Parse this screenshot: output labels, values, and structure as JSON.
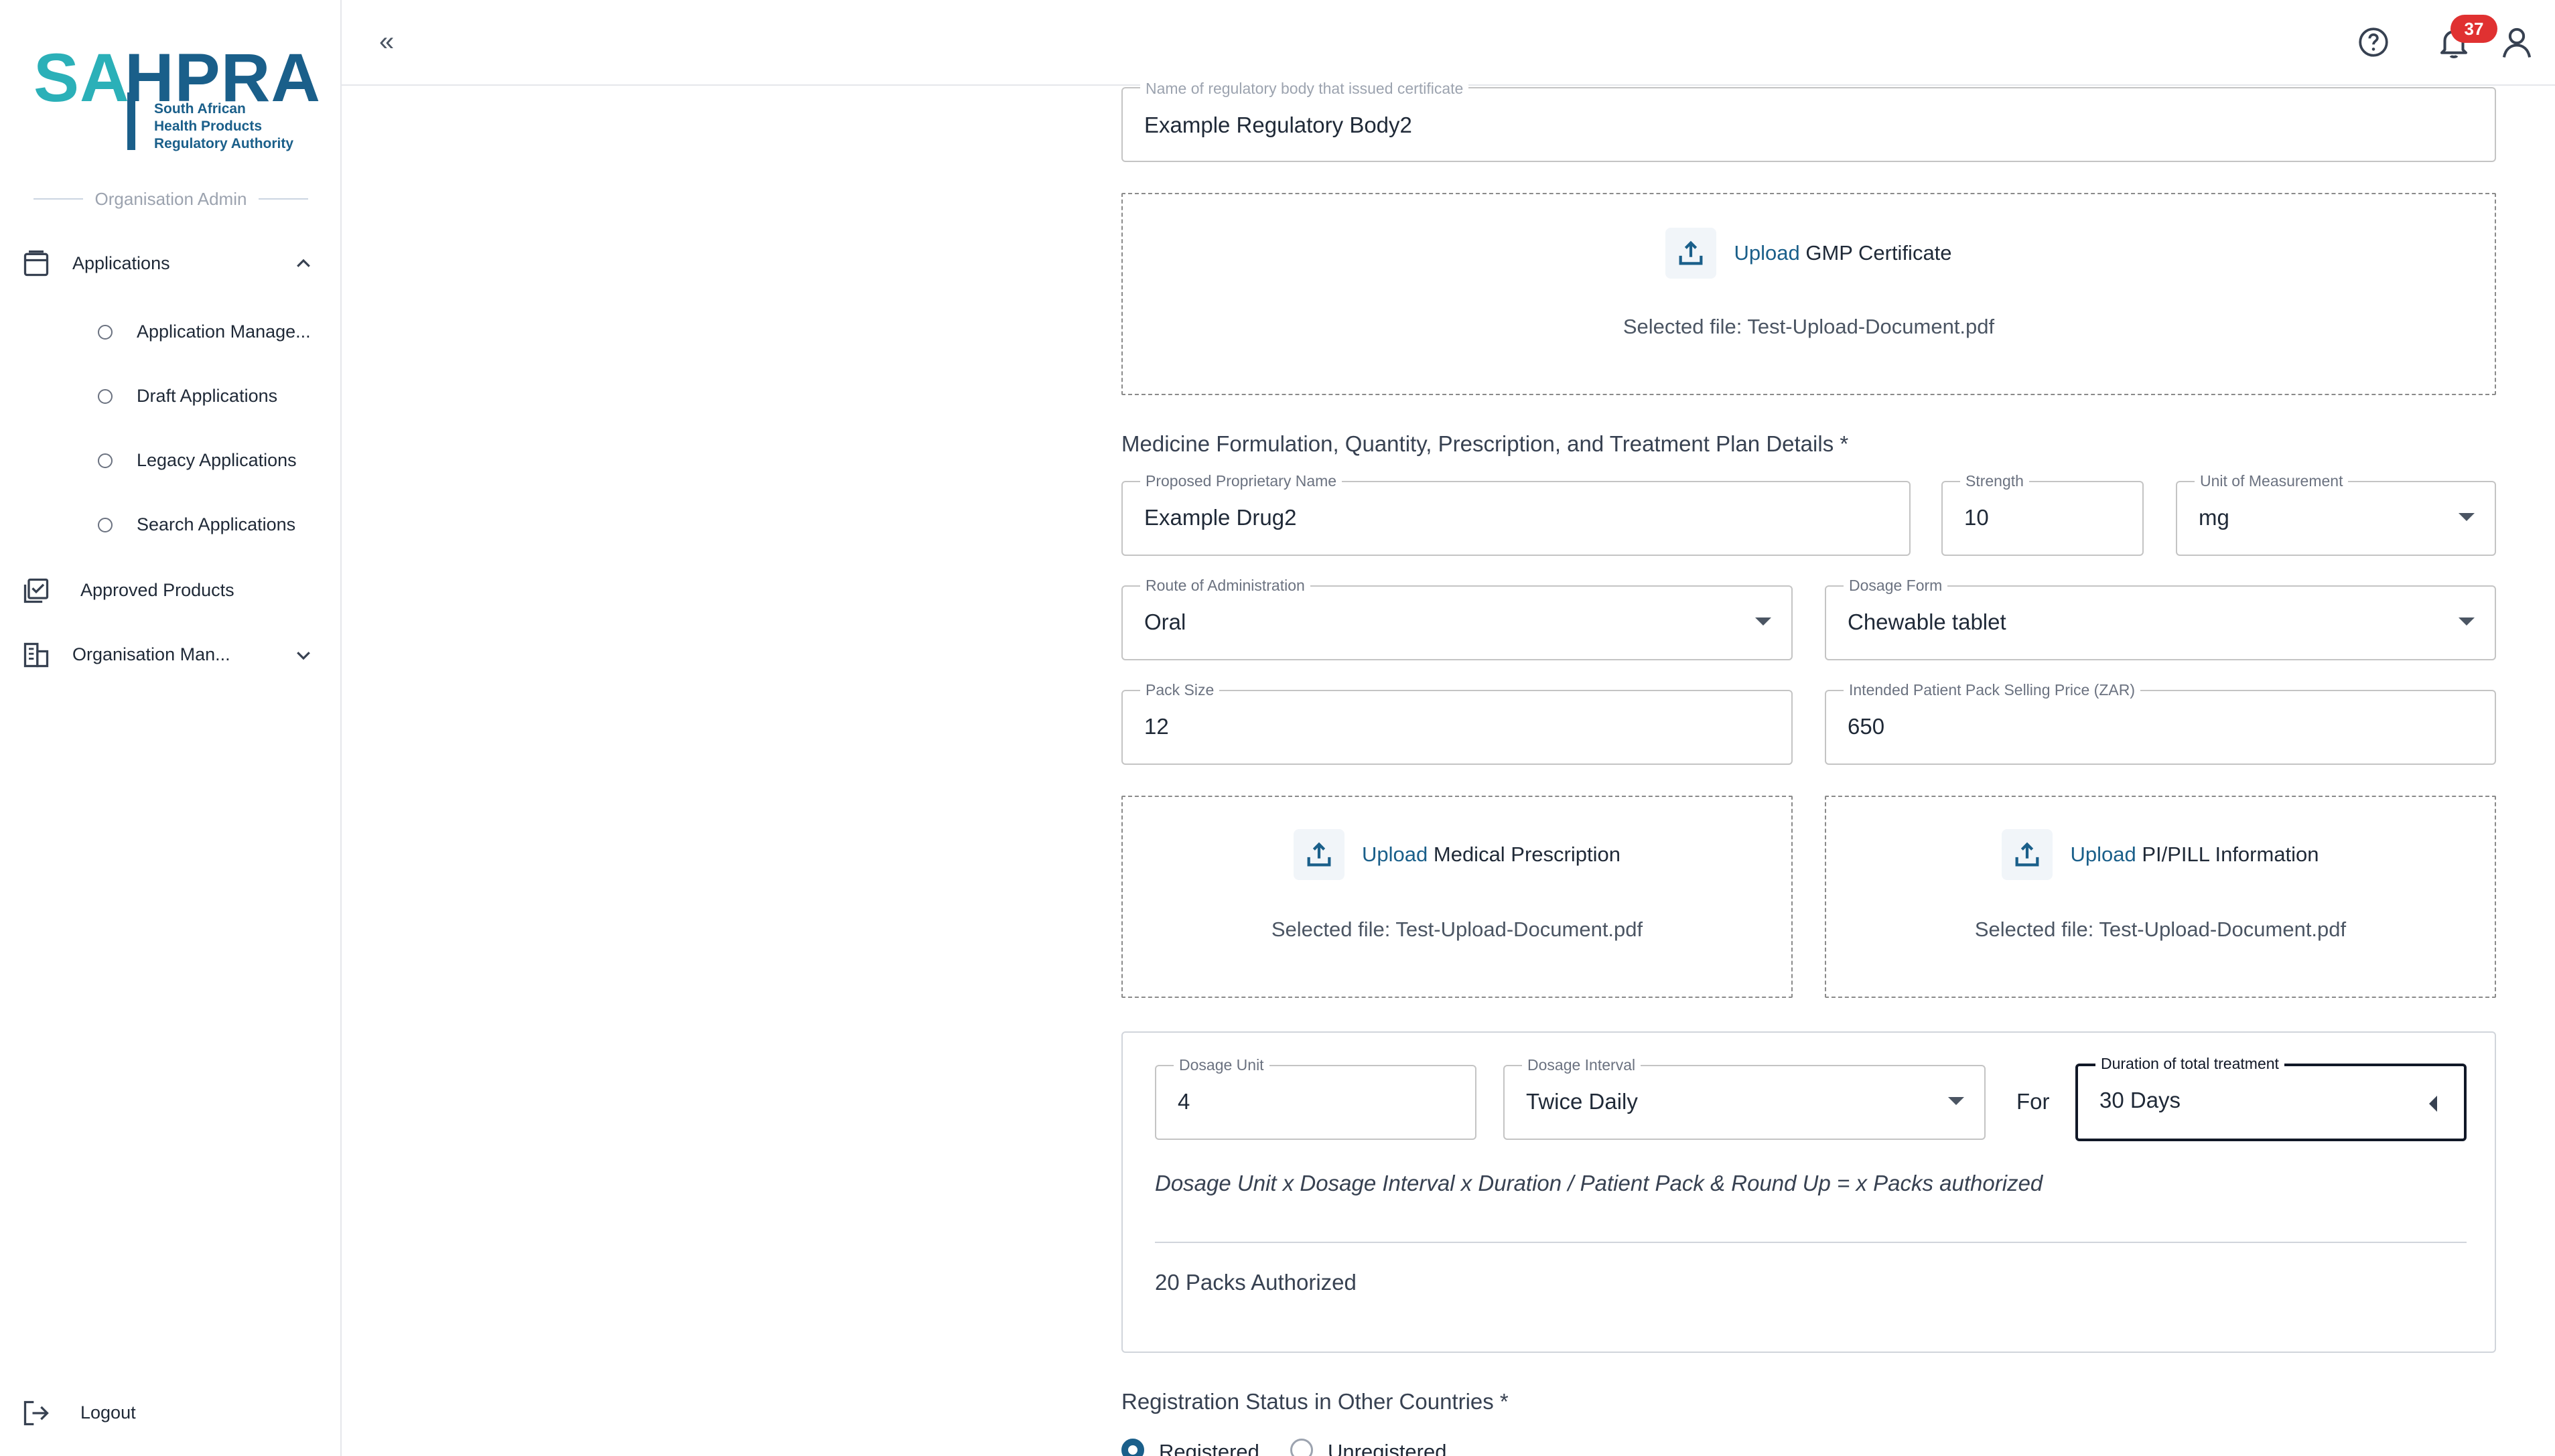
{
  "logo": {
    "short_a": "SA",
    "short_b": "HPRA",
    "line1": "South African",
    "line2": "Health Products",
    "line3": "Regulatory Authority"
  },
  "sidebar": {
    "role": "Organisation Admin",
    "applications_label": "Applications",
    "sub_items": [
      {
        "label": "Application Manage..."
      },
      {
        "label": "Draft Applications"
      },
      {
        "label": "Legacy Applications"
      },
      {
        "label": "Search Applications"
      }
    ],
    "approved_products_label": "Approved Products",
    "organisation_label": "Organisation Man...",
    "logout_label": "Logout"
  },
  "topbar": {
    "collapse_glyph": "«",
    "notification_count": "37"
  },
  "form": {
    "regulatory_body": {
      "label": "Name of regulatory body that issued certificate",
      "value": "Example Regulatory Body2"
    },
    "gmp_upload": {
      "link": "Upload",
      "label": "GMP Certificate",
      "selected": "Selected file: Test-Upload-Document.pdf"
    },
    "section_title": "Medicine Formulation, Quantity, Prescription, and Treatment Plan Details *",
    "proprietary_name": {
      "label": "Proposed Proprietary Name",
      "value": "Example Drug2"
    },
    "strength": {
      "label": "Strength",
      "value": "10"
    },
    "unit": {
      "label": "Unit of Measurement",
      "value": "mg"
    },
    "route": {
      "label": "Route of Administration",
      "value": "Oral"
    },
    "dosage_form": {
      "label": "Dosage Form",
      "value": "Chewable tablet"
    },
    "pack_size": {
      "label": "Pack Size",
      "value": "12"
    },
    "price": {
      "label": "Intended Patient Pack Selling Price (ZAR)",
      "value": "650"
    },
    "prescription_upload": {
      "link": "Upload",
      "label": "Medical Prescription",
      "selected": "Selected file: Test-Upload-Document.pdf"
    },
    "pi_upload": {
      "link": "Upload",
      "label": "PI/PILL Information",
      "selected": "Selected file: Test-Upload-Document.pdf"
    },
    "dosage_unit": {
      "label": "Dosage Unit",
      "value": "4"
    },
    "dosage_interval": {
      "label": "Dosage Interval",
      "value": "Twice Daily"
    },
    "for_label": "For",
    "duration": {
      "label": "Duration of total treatment",
      "value": "30 Days"
    },
    "formula": "Dosage Unit x Dosage Interval x Duration / Patient Pack & Round Up = x Packs authorized",
    "packs_result": "20 Packs Authorized",
    "registration_title": "Registration Status in Other Countries *",
    "radio_registered": "Registered",
    "radio_unregistered": "Unregistered"
  }
}
